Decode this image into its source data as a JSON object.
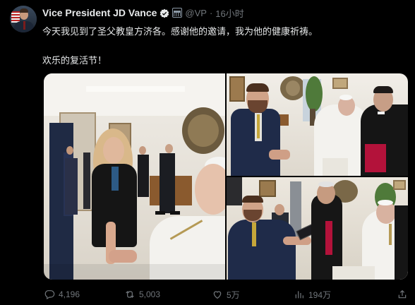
{
  "post": {
    "author_name": "Vice President JD Vance",
    "handle": "@VP",
    "separator": "·",
    "time": "16小时",
    "text_line1": "今天我见到了圣父教皇方济各。感谢他的邀请，我为他的健康祈祷。",
    "text_line2": "欢乐的复活节！"
  },
  "icons": {
    "verified": "verified-badge-icon",
    "government": "government-badge-icon",
    "reply": "reply-icon",
    "repost": "repost-icon",
    "like": "like-icon",
    "views": "views-icon"
  },
  "actions": {
    "replies": "4,196",
    "reposts": "5,003",
    "likes": "5万",
    "views": "194万"
  },
  "colors": {
    "background": "#000000",
    "text": "#e7e9ea",
    "muted": "#71767b",
    "verified": "#1d9bf0"
  }
}
